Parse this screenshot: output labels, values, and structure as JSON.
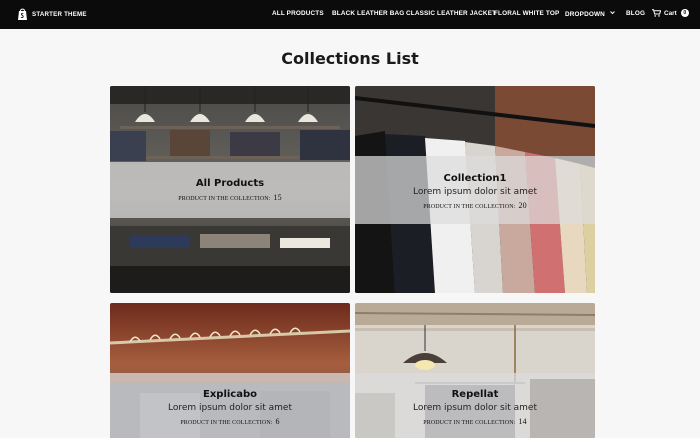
{
  "header": {
    "logo_text": "STARTER THEME",
    "nav": [
      {
        "label": "ALL PRODUCTS"
      },
      {
        "label": "BLACK LEATHER BAG"
      },
      {
        "label": "CLASSIC LEATHER JACKET"
      },
      {
        "label": "FLORAL WHITE TOP"
      },
      {
        "label": "DROPDOWN"
      },
      {
        "label": "BLOG"
      }
    ],
    "cart_label": "Cart",
    "cart_count": "0"
  },
  "page_title": "Collections List",
  "collections": [
    {
      "title": "All Products",
      "description": "",
      "count_label": "PRODUCT IN THE COLLECTION:",
      "count": "15"
    },
    {
      "title": "Collection1",
      "description": "Lorem ipsum dolor sit amet",
      "count_label": "PRODUCT IN THE COLLECTION:",
      "count": "20"
    },
    {
      "title": "Explicabo",
      "description": "Lorem ipsum dolor sit amet",
      "count_label": "PRODUCT IN THE COLLECTION:",
      "count": "6"
    },
    {
      "title": "Repellat",
      "description": "Lorem ipsum dolor sit amet",
      "count_label": "PRODUCT IN THE COLLECTION:",
      "count": "14"
    }
  ],
  "icons": {
    "logo": "shopify-bag-icon",
    "cart": "cart-icon",
    "dropdown": "chevron-down-icon"
  },
  "colors": {
    "topbar": "#0b0b0b",
    "background": "#f7f7f7",
    "overlay": "#dcdcdc"
  }
}
